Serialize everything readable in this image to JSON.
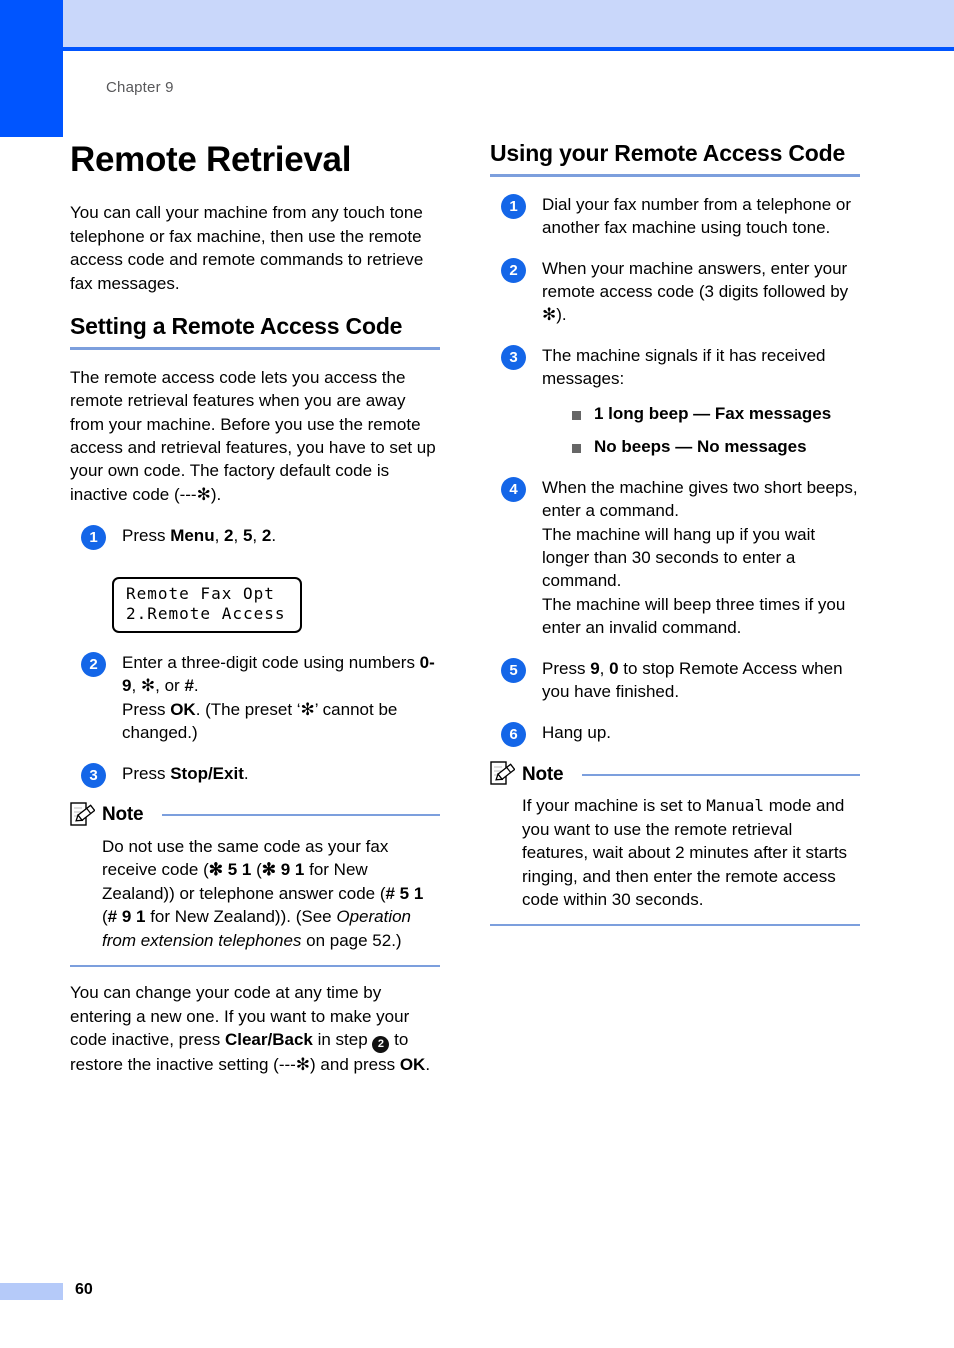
{
  "page": {
    "chapter": "Chapter 9",
    "page_number": "60",
    "accent_blue": "#0055ff",
    "band_blue": "#c9d7fa",
    "rule_blue": "#7c9fdd",
    "step_circle_blue": "#1466e8"
  },
  "left": {
    "title": "Remote Retrieval",
    "intro": "You can call your machine from any touch tone telephone or fax machine, then use the remote access code and remote commands to retrieve fax messages.",
    "section_heading": "Setting a Remote Access Code",
    "section_intro": "The remote access code lets you access the remote retrieval features when you are away from your machine. Before you use the remote access and retrieval features, you have to set up your own code. The factory default code is inactive code (---✻).",
    "steps": {
      "s1_num": "1",
      "s1_text_a": "Press ",
      "s1_menu": "Menu",
      "s1_text_b": ", ",
      "s1_d1": "2",
      "s1_text_c": ", ",
      "s1_d2": "5",
      "s1_text_d": ", ",
      "s1_d3": "2",
      "s1_text_e": ".",
      "s2_num": "2",
      "s2_l1_a": "Enter a three-digit code using numbers ",
      "s2_l1_b": "0-9",
      "s2_l1_c": ", ✻, or ",
      "s2_l1_d": "#",
      "s2_l1_e": ".",
      "s2_l2_a": "Press ",
      "s2_l2_b": "OK",
      "s2_l2_c": ". (The preset ‘✻’ cannot be changed.)",
      "s3_num": "3",
      "s3_a": "Press ",
      "s3_b": "Stop/Exit",
      "s3_c": "."
    },
    "lcd": {
      "line1": "Remote Fax Opt",
      "line2": "2.Remote Access"
    },
    "note": {
      "label": "Note",
      "t1": "Do not use the same code as your fax receive code (",
      "b1": "✻ 5 1",
      "t2": " (",
      "b2": "✻ 9 1",
      "t3": " for New Zealand)) or telephone answer code (",
      "b3": "# 5 1",
      "t4": " (",
      "b4": "# 9 1",
      "t5": " for New Zealand)). (See ",
      "i1": "Operation from extension telephones",
      "t6": " on page 52.)"
    },
    "closing": {
      "a": "You can change your code at any time by entering a new one. If you want to make your code inactive, press ",
      "b": "Clear/Back",
      "c": " in step ",
      "step_ref": "2",
      "d": " to restore the inactive setting (---✻) and press ",
      "e": "OK",
      "f": "."
    }
  },
  "right": {
    "section_heading": "Using your Remote Access Code",
    "steps": {
      "s1_num": "1",
      "s1_text": "Dial your fax number from a telephone or another fax machine using touch tone.",
      "s2_num": "2",
      "s2_text": "When your machine answers, enter your remote access code (3 digits followed by ✻).",
      "s3_num": "3",
      "s3_text": "The machine signals if it has received messages:",
      "s3_bullets": [
        "1 long beep — Fax messages",
        "No beeps — No messages"
      ],
      "s4_num": "4",
      "s4_l1": "When the machine gives two short beeps, enter a command.",
      "s4_l2": "The machine will hang up if you wait longer than 30 seconds to enter a command.",
      "s4_l3": "The machine will beep three times if you enter an invalid command.",
      "s5_num": "5",
      "s5_a": "Press ",
      "s5_b": "9",
      "s5_c": ", ",
      "s5_d": "0",
      "s5_e": " to stop Remote Access when you have finished.",
      "s6_num": "6",
      "s6_text": "Hang up."
    },
    "note": {
      "label": "Note",
      "t1": "If your machine is set to ",
      "m1": "Manual",
      "t2": " mode and you want to use the remote retrieval features, wait about 2 minutes after it starts ringing, and then enter the remote access code within 30 seconds."
    }
  }
}
